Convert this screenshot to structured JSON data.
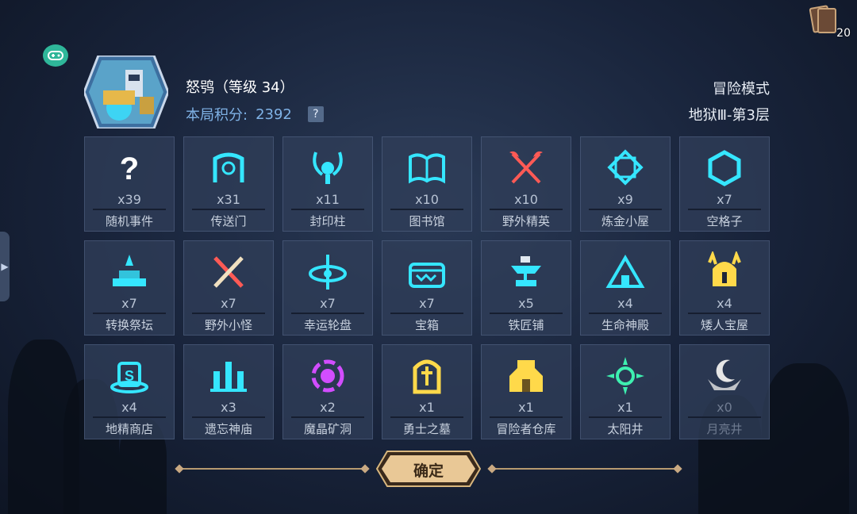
{
  "top_right": {
    "deck_count": "20"
  },
  "player": {
    "name_level": "怒鸮（等级 34）",
    "score_label": "本局积分:",
    "score_value": "2392",
    "help": "?"
  },
  "mode": {
    "title": "冒险模式",
    "floor": "地狱Ⅲ-第3层"
  },
  "tiles": [
    {
      "count": "x39",
      "label": "随机事件",
      "icon": "question-icon",
      "color": "#ffffff"
    },
    {
      "count": "x31",
      "label": "传送门",
      "icon": "portal-icon",
      "color": "#35e6ff"
    },
    {
      "count": "x11",
      "label": "封印柱",
      "icon": "seal-pillar-icon",
      "color": "#35e6ff"
    },
    {
      "count": "x10",
      "label": "图书馆",
      "icon": "book-icon",
      "color": "#35e6ff"
    },
    {
      "count": "x10",
      "label": "野外精英",
      "icon": "crossed-axes-icon",
      "color": "#ff5a55"
    },
    {
      "count": "x9",
      "label": "炼金小屋",
      "icon": "alchemy-icon",
      "color": "#35e6ff"
    },
    {
      "count": "x7",
      "label": "空格子",
      "icon": "hexagon-icon",
      "color": "#35e6ff"
    },
    {
      "count": "x7",
      "label": "转换祭坛",
      "icon": "altar-icon",
      "color": "#35e6ff"
    },
    {
      "count": "x7",
      "label": "野外小怪",
      "icon": "crossed-swords-icon",
      "color": "#ff5a55"
    },
    {
      "count": "x7",
      "label": "幸运轮盘",
      "icon": "wheel-icon",
      "color": "#35e6ff"
    },
    {
      "count": "x7",
      "label": "宝箱",
      "icon": "chest-icon",
      "color": "#35e6ff"
    },
    {
      "count": "x5",
      "label": "铁匠铺",
      "icon": "anvil-icon",
      "color": "#35e6ff"
    },
    {
      "count": "x4",
      "label": "生命神殿",
      "icon": "temple-icon",
      "color": "#35e6ff"
    },
    {
      "count": "x4",
      "label": "矮人宝屋",
      "icon": "dwarf-helmet-icon",
      "color": "#ffd94a"
    },
    {
      "count": "x4",
      "label": "地精商店",
      "icon": "goblin-shop-icon",
      "color": "#35e6ff"
    },
    {
      "count": "x3",
      "label": "遗忘神庙",
      "icon": "forgotten-temple-icon",
      "color": "#35e6ff"
    },
    {
      "count": "x2",
      "label": "魔晶矿洞",
      "icon": "crystal-mine-icon",
      "color": "#d24dff"
    },
    {
      "count": "x1",
      "label": "勇士之墓",
      "icon": "tomb-icon",
      "color": "#ffd94a"
    },
    {
      "count": "x1",
      "label": "冒险者仓库",
      "icon": "warehouse-icon",
      "color": "#ffd94a"
    },
    {
      "count": "x1",
      "label": "太阳井",
      "icon": "sun-well-icon",
      "color": "#3ef0b0"
    },
    {
      "count": "x0",
      "label": "月亮井",
      "icon": "moon-well-icon",
      "color": "#e6e6e6"
    }
  ],
  "confirm": {
    "label": "确定"
  }
}
